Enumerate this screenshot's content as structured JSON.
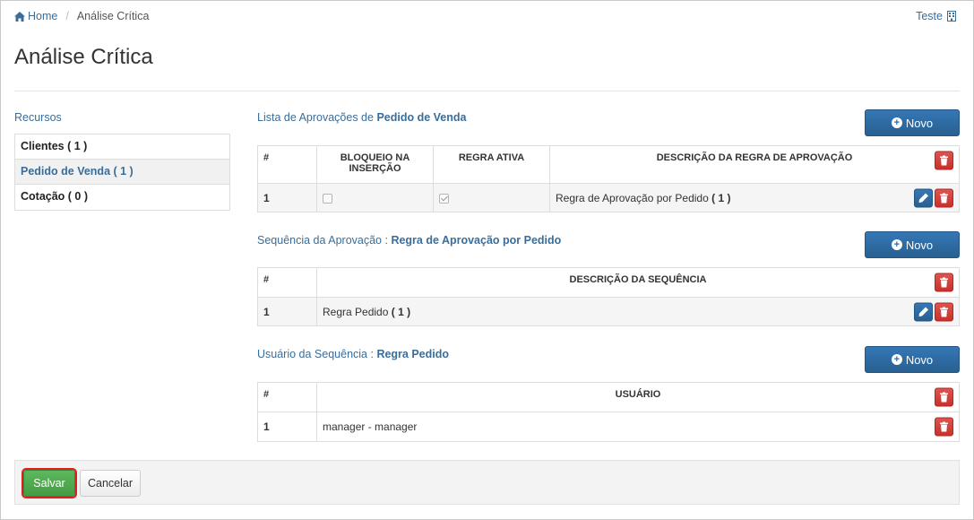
{
  "breadcrumb": {
    "home": "Home",
    "separator": "/",
    "current": "Análise Crítica"
  },
  "user": {
    "name": "Teste",
    "icon": "building-icon"
  },
  "page_title": "Análise Crítica",
  "resources": {
    "title": "Recursos",
    "items": [
      {
        "label": "Clientes ( 1 )",
        "active": false
      },
      {
        "label": "Pedido de Venda ( 1 )",
        "active": true
      },
      {
        "label": "Cotação ( 0 )",
        "active": false
      }
    ]
  },
  "approvals": {
    "title_prefix": "Lista de Aprovações de",
    "title_target": "Pedido de Venda",
    "new_label": "Novo",
    "columns": [
      "#",
      "BLOQUEIO NA INSERÇÃO",
      "REGRA ATIVA",
      "DESCRIÇÃO DA REGRA DE APROVAÇÃO"
    ],
    "rows": [
      {
        "num": "1",
        "block": false,
        "active": true,
        "description": "Regra de Aprovação por Pedido",
        "count": "( 1 )"
      }
    ]
  },
  "sequence": {
    "title_prefix": "Sequência da Aprovação :",
    "title_target": "Regra de Aprovação por Pedido",
    "new_label": "Novo",
    "columns": [
      "#",
      "DESCRIÇÃO DA SEQUÊNCIA"
    ],
    "rows": [
      {
        "num": "1",
        "description": "Regra Pedido",
        "count": "( 1 )"
      }
    ]
  },
  "users": {
    "title_prefix": "Usuário da Sequência :",
    "title_target": "Regra Pedido",
    "new_label": "Novo",
    "columns": [
      "#",
      "USUÁRIO"
    ],
    "rows": [
      {
        "num": "1",
        "user": "manager - manager"
      }
    ]
  },
  "footer": {
    "save_label": "Salvar",
    "cancel_label": "Cancelar"
  },
  "colors": {
    "primary": "#2e6da4",
    "danger": "#c9302c",
    "success": "#449d44",
    "link": "#3a6d99",
    "highlight": "#e02020"
  }
}
